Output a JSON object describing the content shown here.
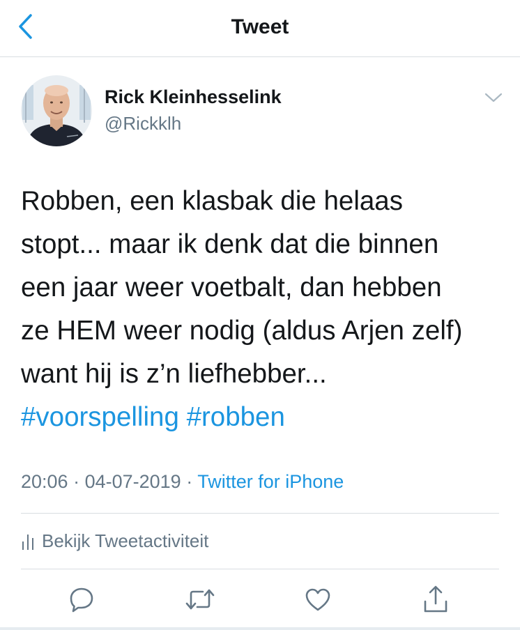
{
  "navbar": {
    "title": "Tweet",
    "back_icon": "chevron-left-icon"
  },
  "author": {
    "name": "Rick Kleinhesselink",
    "handle": "@Rickklh"
  },
  "tweet": {
    "lines": [
      "Robben, een klasbak die helaas",
      "stopt... maar ik denk dat die binnen",
      "een jaar weer voetbalt, dan hebben",
      "ze HEM weer nodig (aldus Arjen zelf)",
      "want hij is z’n liefhebber..."
    ],
    "hashtags": [
      "#voorspelling",
      "#robben"
    ]
  },
  "meta": {
    "time": "20:06",
    "separator": " · ",
    "date": "04-07-2019",
    "source": "Twitter for iPhone"
  },
  "activity": {
    "label": "Bekijk Tweetactiviteit",
    "icon": "bar-chart-icon"
  },
  "actions": {
    "icons": [
      "reply-icon",
      "retweet-icon",
      "like-icon",
      "share-icon"
    ]
  },
  "colors": {
    "accent": "#1b95e0",
    "text": "#14171a",
    "secondary": "#657786",
    "divider": "#d8dde1"
  }
}
